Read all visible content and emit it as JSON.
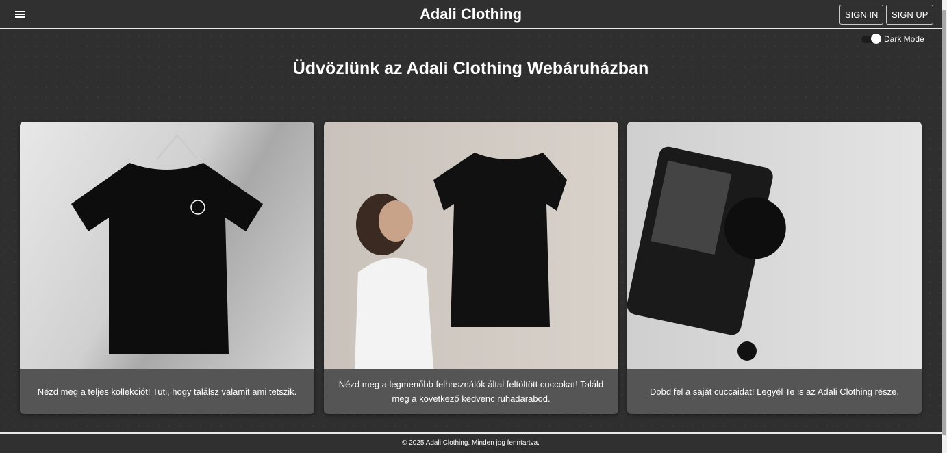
{
  "header": {
    "title": "Adali Clothing",
    "sign_in": "SIGN IN",
    "sign_up": "SIGN UP"
  },
  "dark_mode": {
    "label": "Dark Mode",
    "enabled": true
  },
  "main": {
    "heading": "Üdvözlünk az Adali Clothing Webáruházban",
    "cards": [
      {
        "image": "black-tshirt-on-hanger",
        "caption": "Nézd meg a teljes kollekciót! Tuti, hogy találsz valamit ami tetszik."
      },
      {
        "image": "woman-holding-black-tshirt",
        "caption": "Nézd meg a legmenőbb felhasználók által feltöltött cuccokat! Találd meg a következő kedvenc ruhadarabod."
      },
      {
        "image": "camera-on-wall",
        "caption": "Dobd fel a saját cuccaidat! Legyél Te is az Adali Clothing része."
      }
    ]
  },
  "footer": {
    "text": "© 2025 Adali Clothing. Minden jog fenntartva."
  }
}
